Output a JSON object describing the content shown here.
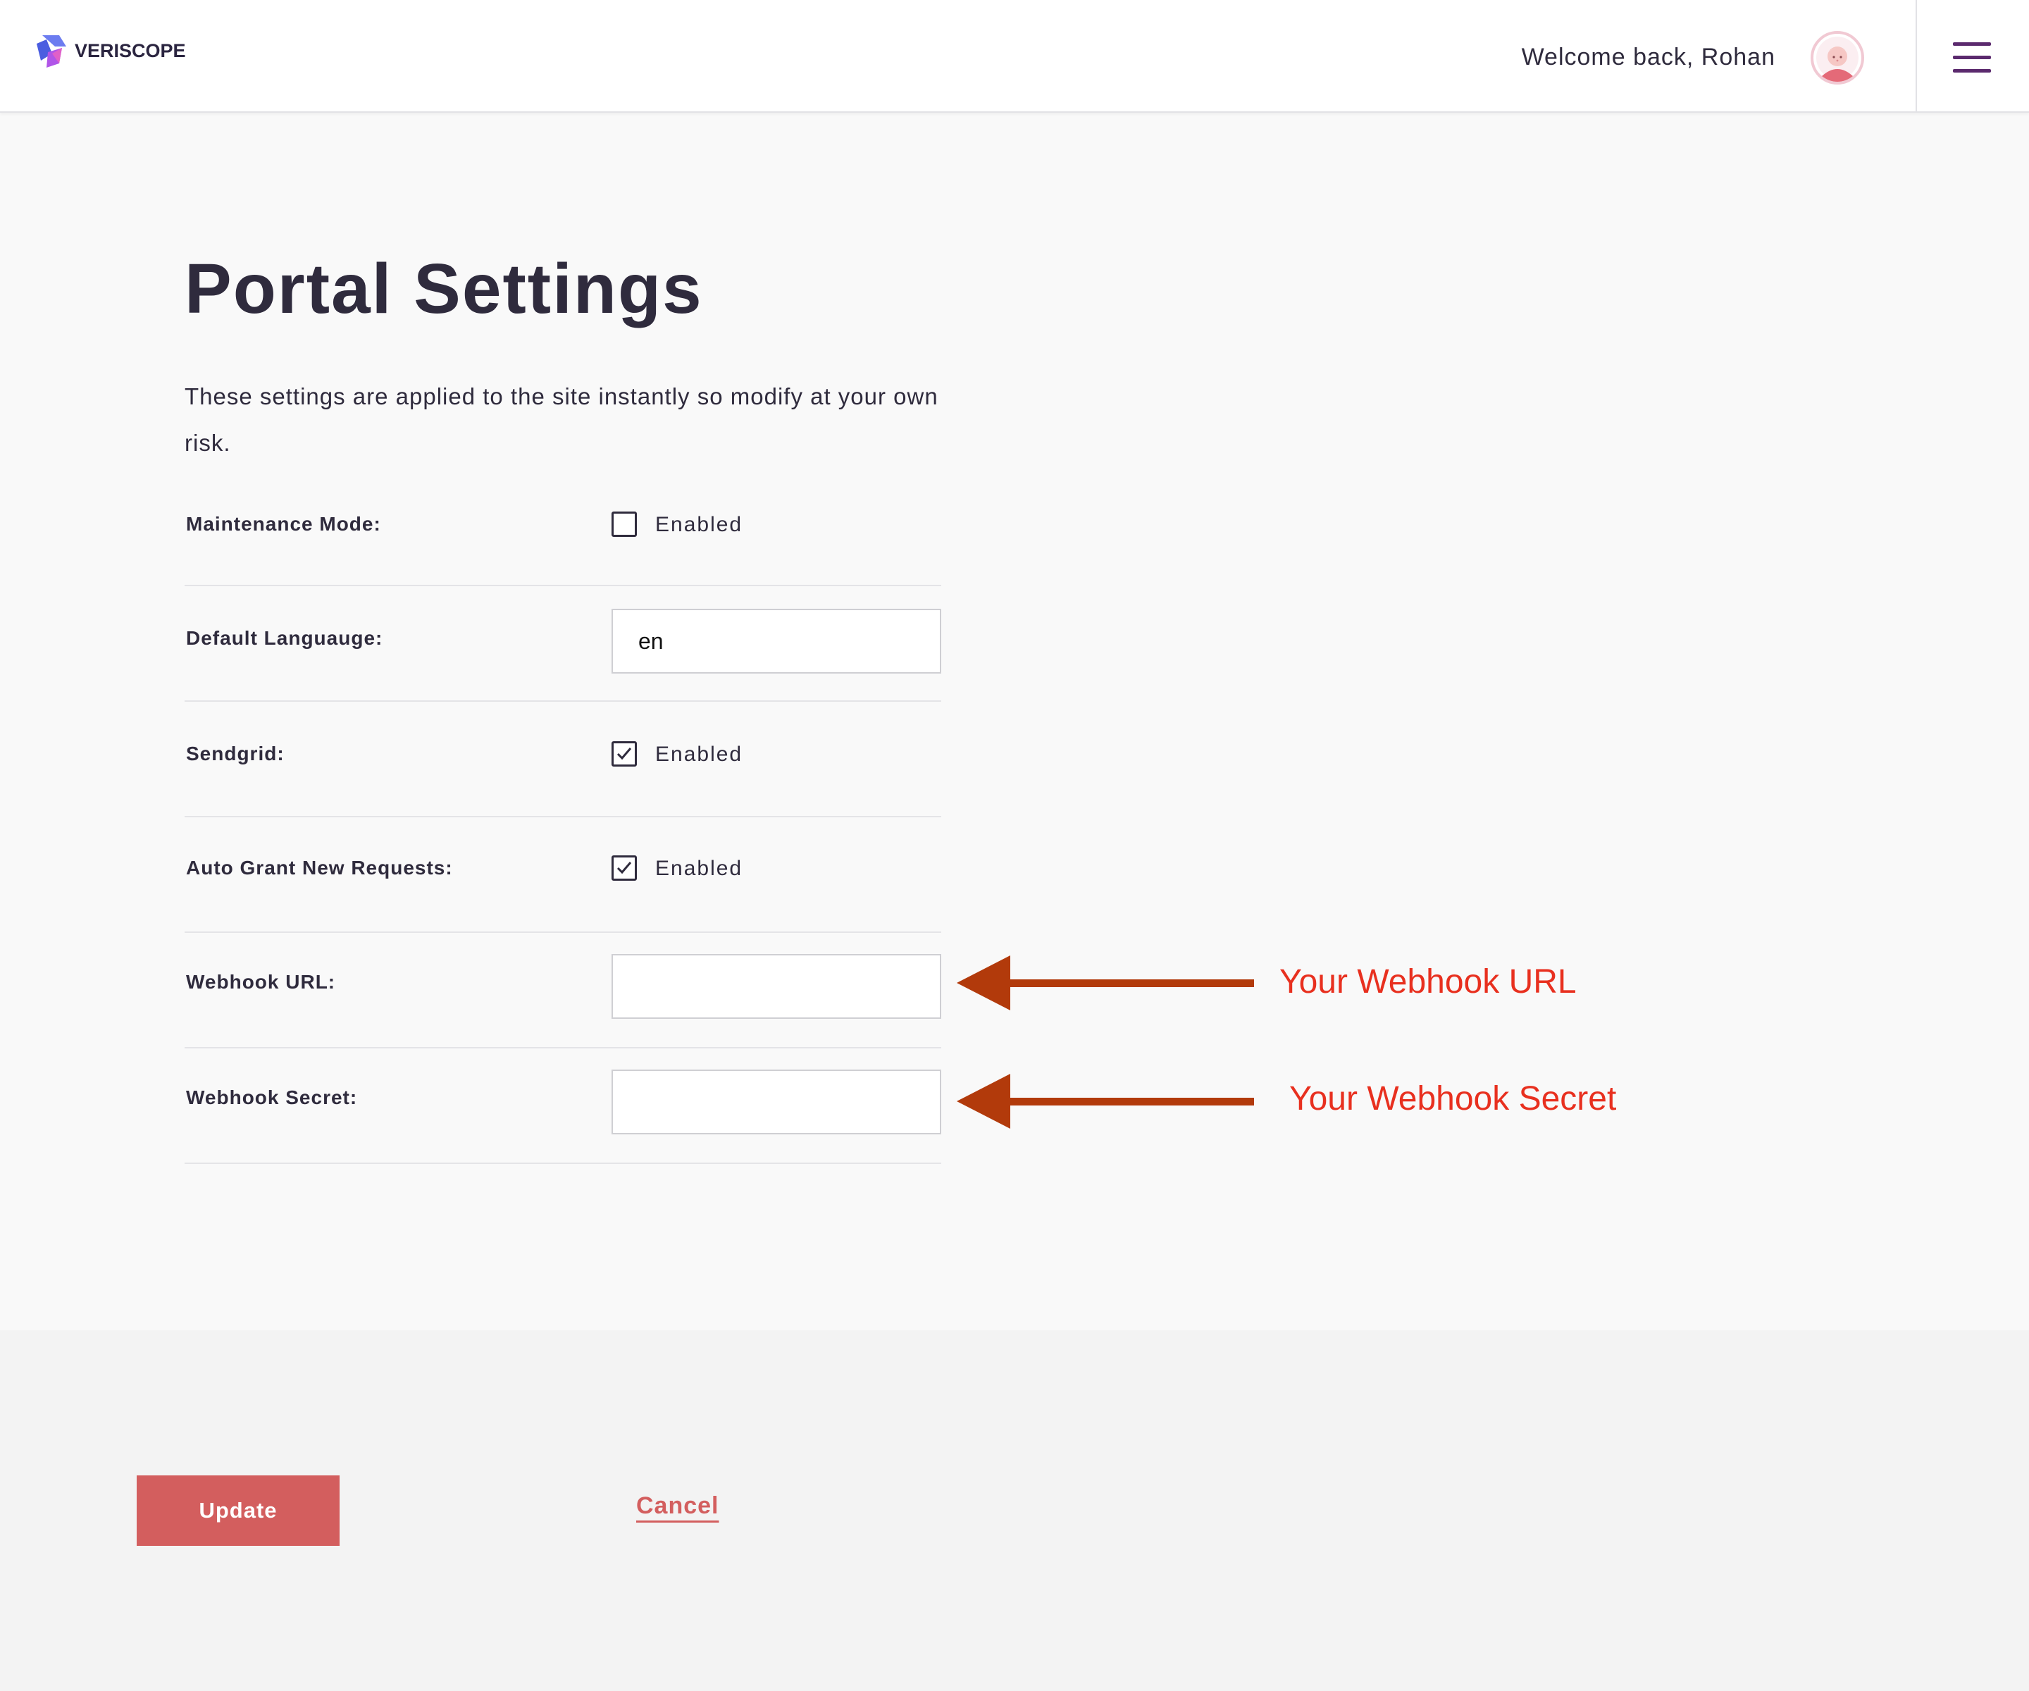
{
  "brand": {
    "name": "VERISCOPE",
    "logo_icon": "veriscope-logo-icon"
  },
  "header": {
    "welcome_text": "Welcome back, Rohan",
    "avatar_icon": "user-avatar-icon",
    "menu_icon": "hamburger-menu-icon"
  },
  "page": {
    "title": "Portal Settings",
    "description": "These settings are applied to the site instantly so modify at your own risk."
  },
  "settings": [
    {
      "label": "Maintenance Mode:",
      "type": "checkbox",
      "checked": false,
      "option_label": "Enabled"
    },
    {
      "label": "Default Languauge:",
      "type": "text",
      "value": "en",
      "placeholder": ""
    },
    {
      "label": "Sendgrid:",
      "type": "checkbox",
      "checked": true,
      "option_label": "Enabled"
    },
    {
      "label": "Auto Grant New Requests:",
      "type": "checkbox",
      "checked": true,
      "option_label": "Enabled"
    },
    {
      "label": "Webhook URL:",
      "type": "text",
      "value": "",
      "placeholder": ""
    },
    {
      "label": "Webhook Secret:",
      "type": "text",
      "value": "",
      "placeholder": ""
    }
  ],
  "actions": {
    "update_label": "Update",
    "cancel_label": "Cancel"
  },
  "annotations": [
    {
      "text": "Your Webhook URL",
      "target": "Webhook URL:"
    },
    {
      "text": "Your Webhook Secret",
      "target": "Webhook Secret:"
    }
  ],
  "colors": {
    "accent": "#d35e5e",
    "menu_icon": "#5b2a6e",
    "annotation_text": "#e8301f",
    "annotation_arrow": "#b23a0b",
    "page_background": "#f9f9f9",
    "footer_background": "#f3f3f3"
  }
}
